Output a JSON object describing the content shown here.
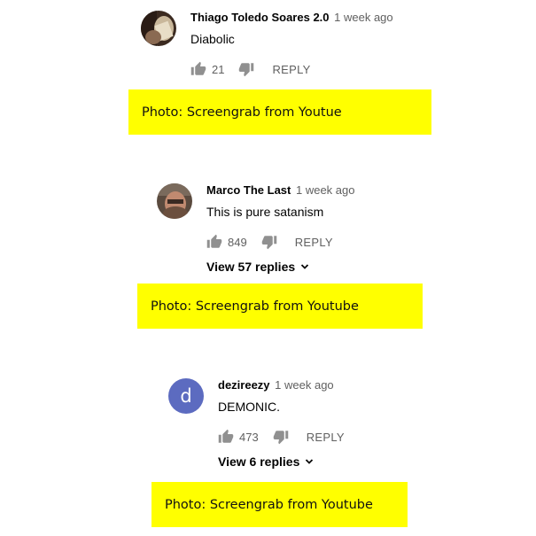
{
  "comments": [
    {
      "author": "Thiago Toledo Soares 2.0",
      "time": "1 week ago",
      "text": "Diabolic",
      "likes": "21",
      "reply_label": "REPLY",
      "avatar_icon": "photo-avatar"
    },
    {
      "author": "Marco The Last",
      "time": "1 week ago",
      "text": "This is pure satanism",
      "likes": "849",
      "reply_label": "REPLY",
      "view_replies": "View 57 replies",
      "avatar_icon": "photo-avatar"
    },
    {
      "author": "dezireezy",
      "time": "1 week ago",
      "text": "DEMONIC.",
      "likes": "473",
      "reply_label": "REPLY",
      "view_replies": "View 6 replies",
      "avatar_letter": "d",
      "avatar_color": "#5c6bc0"
    }
  ],
  "captions": [
    "Photo: Screengrab from Youtue",
    "Photo: Screengrab from Youtube",
    "Photo: Screengrab from Youtube"
  ],
  "colors": {
    "caption_bg": "#ffff00",
    "secondary_text": "#606060"
  }
}
